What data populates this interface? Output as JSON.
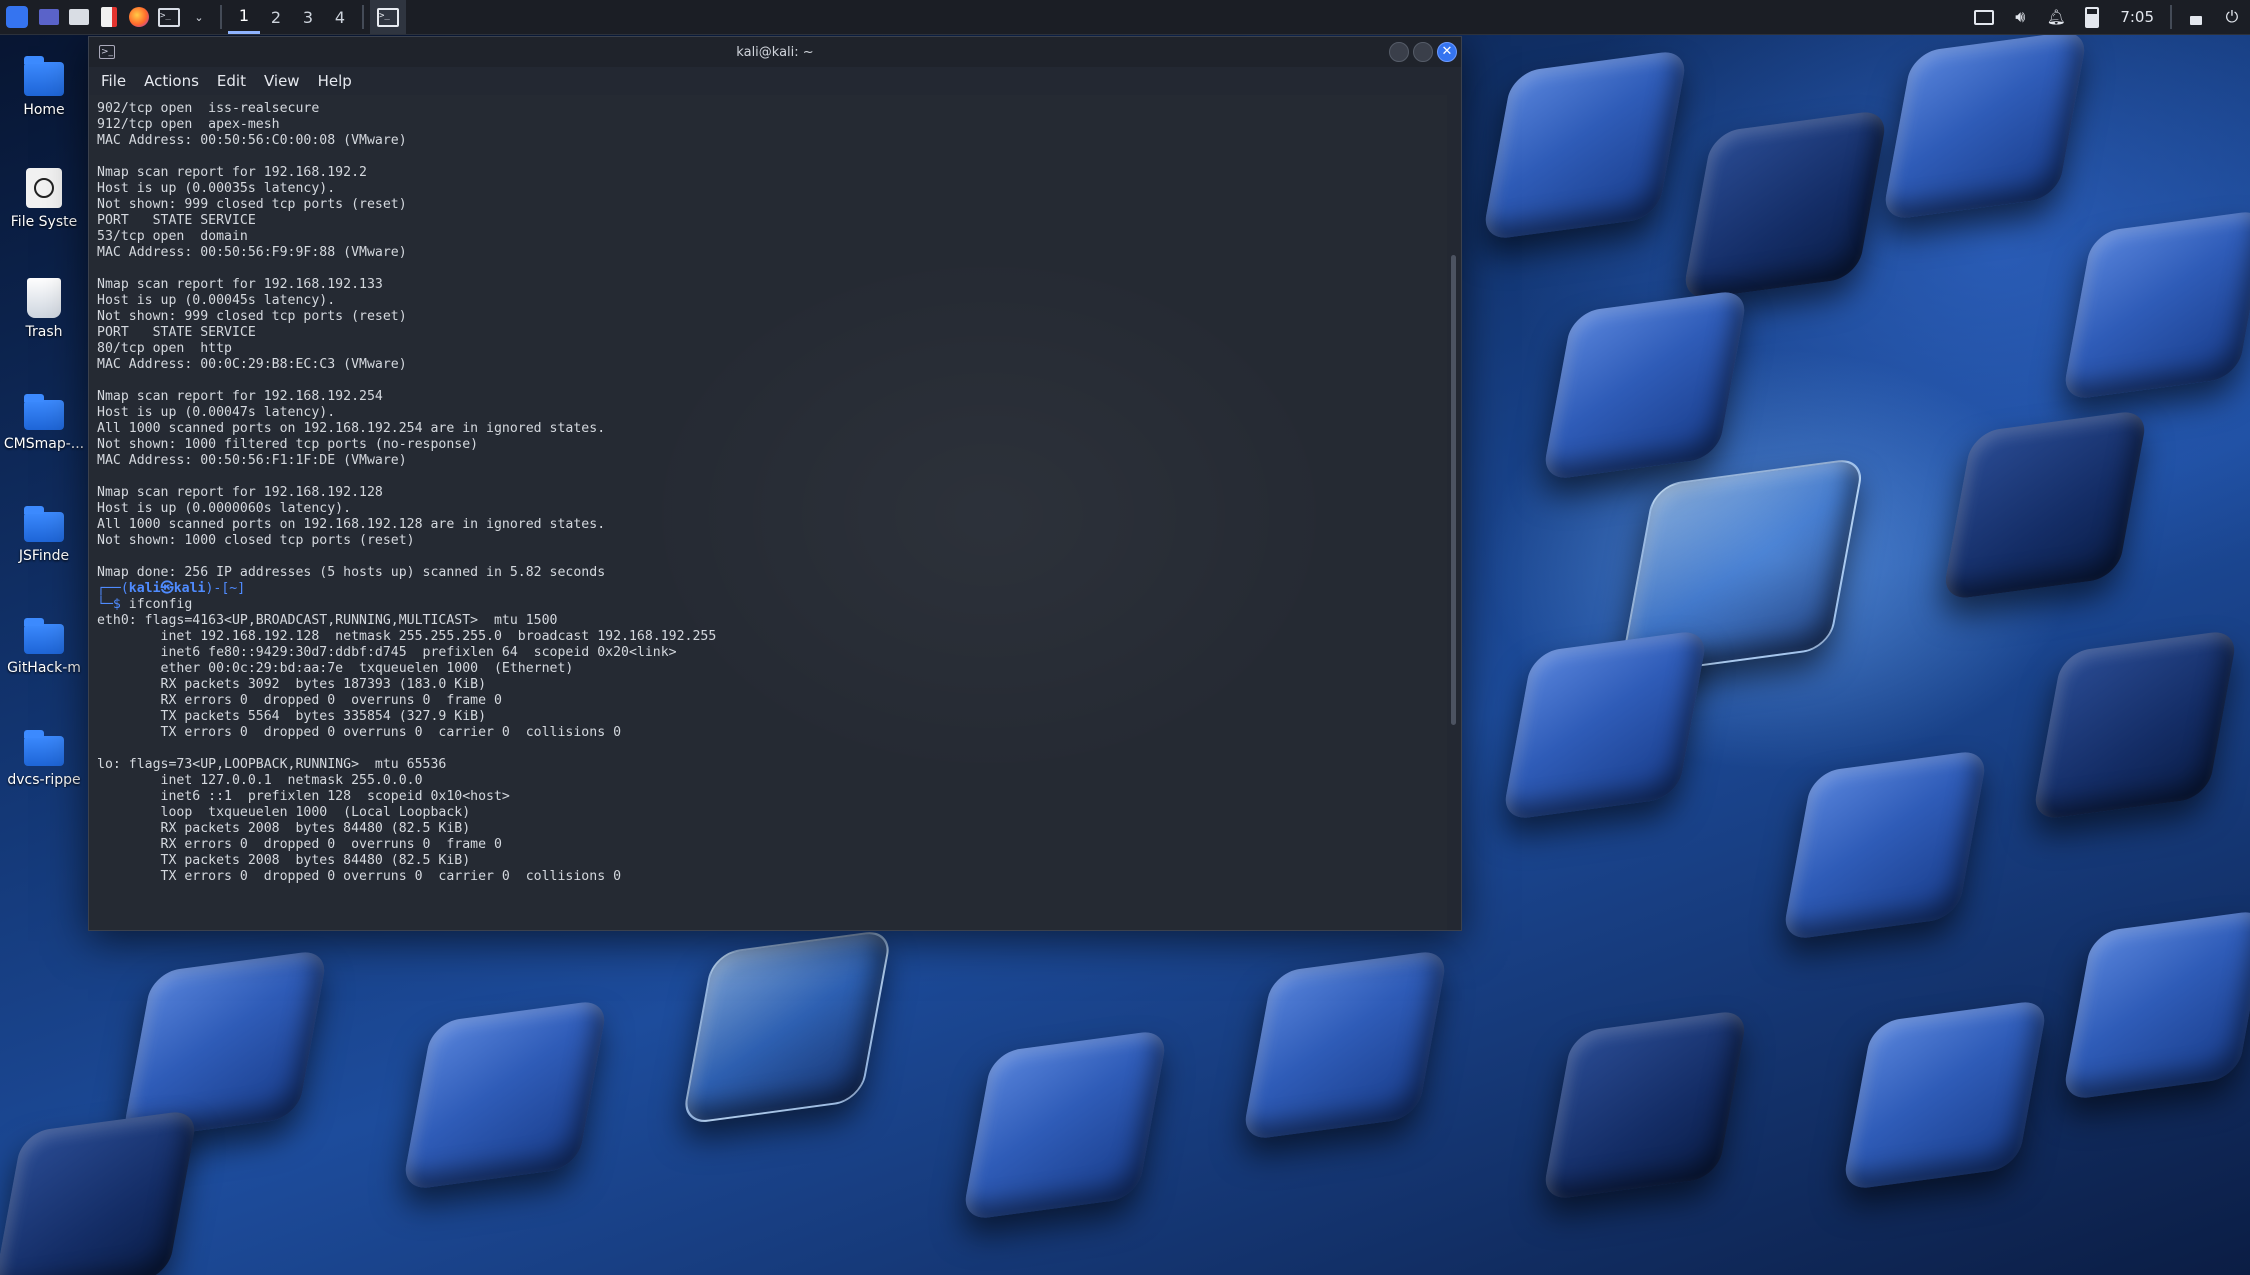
{
  "colors": {
    "accent": "#3574f0",
    "panel_bg": "#1b1e25",
    "terminal_bg": "#252a33",
    "prompt_blue": "#4f8bff"
  },
  "panel": {
    "launchers": [
      {
        "name": "kali-menu-icon"
      },
      {
        "name": "show-desktop-icon"
      },
      {
        "name": "file-manager-icon"
      },
      {
        "name": "text-editor-icon"
      },
      {
        "name": "firefox-icon"
      },
      {
        "name": "terminal-icon"
      }
    ],
    "workspaces": [
      "1",
      "2",
      "3",
      "4"
    ],
    "active_workspace": "1",
    "clock": "7:05"
  },
  "desktop": {
    "icons": [
      {
        "label": "Home",
        "icon": "home-folder-icon"
      },
      {
        "label": "File Syste",
        "icon": "drive-icon"
      },
      {
        "label": "Trash",
        "icon": "trash-icon"
      },
      {
        "label": "CMSmap-...",
        "icon": "folder-icon"
      },
      {
        "label": "JSFinde",
        "icon": "folder-icon"
      },
      {
        "label": "GitHack-m",
        "icon": "folder-icon"
      },
      {
        "label": "dvcs-rippe",
        "icon": "folder-icon"
      }
    ]
  },
  "window": {
    "title": "kali@kali: ~",
    "menu": [
      "File",
      "Actions",
      "Edit",
      "View",
      "Help"
    ]
  },
  "terminal": {
    "block1": "902/tcp open  iss-realsecure\n912/tcp open  apex-mesh\nMAC Address: 00:50:56:C0:00:08 (VMware)\n\nNmap scan report for 192.168.192.2\nHost is up (0.00035s latency).\nNot shown: 999 closed tcp ports (reset)\nPORT   STATE SERVICE\n53/tcp open  domain\nMAC Address: 00:50:56:F9:9F:88 (VMware)\n\nNmap scan report for 192.168.192.133\nHost is up (0.00045s latency).\nNot shown: 999 closed tcp ports (reset)\nPORT   STATE SERVICE\n80/tcp open  http\nMAC Address: 00:0C:29:B8:EC:C3 (VMware)\n\nNmap scan report for 192.168.192.254\nHost is up (0.00047s latency).\nAll 1000 scanned ports on 192.168.192.254 are in ignored states.\nNot shown: 1000 filtered tcp ports (no-response)\nMAC Address: 00:50:56:F1:1F:DE (VMware)\n\nNmap scan report for 192.168.192.128\nHost is up (0.0000060s latency).\nAll 1000 scanned ports on 192.168.192.128 are in ignored states.\nNot shown: 1000 closed tcp ports (reset)\n\nNmap done: 256 IP addresses (5 hosts up) scanned in 5.82 seconds\n",
    "prompt_prefix": "┌──(",
    "prompt_user": "kali㉿kali",
    "prompt_suffix": ")-[~]",
    "prompt_dollar": "└─$ ",
    "command": "ifconfig",
    "block2": "eth0: flags=4163<UP,BROADCAST,RUNNING,MULTICAST>  mtu 1500\n        inet 192.168.192.128  netmask 255.255.255.0  broadcast 192.168.192.255\n        inet6 fe80::9429:30d7:ddbf:d745  prefixlen 64  scopeid 0x20<link>\n        ether 00:0c:29:bd:aa:7e  txqueuelen 1000  (Ethernet)\n        RX packets 3092  bytes 187393 (183.0 KiB)\n        RX errors 0  dropped 0  overruns 0  frame 0\n        TX packets 5564  bytes 335854 (327.9 KiB)\n        TX errors 0  dropped 0 overruns 0  carrier 0  collisions 0\n\nlo: flags=73<UP,LOOPBACK,RUNNING>  mtu 65536\n        inet 127.0.0.1  netmask 255.0.0.0\n        inet6 ::1  prefixlen 128  scopeid 0x10<host>\n        loop  txqueuelen 1000  (Local Loopback)\n        RX packets 2008  bytes 84480 (82.5 KiB)\n        RX errors 0  dropped 0  overruns 0  frame 0\n        TX packets 2008  bytes 84480 (82.5 KiB)\n        TX errors 0  dropped 0 overruns 0  carrier 0  collisions 0"
  }
}
